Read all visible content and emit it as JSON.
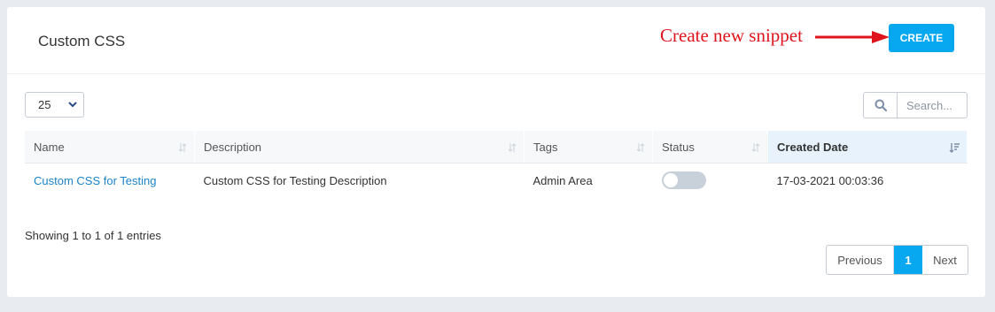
{
  "header": {
    "title": "Custom CSS",
    "annotation": "Create new snippet",
    "create_label": "CREATE"
  },
  "controls": {
    "page_length": "25",
    "search_placeholder": "Search..."
  },
  "table": {
    "columns": [
      "Name",
      "Description",
      "Tags",
      "Status",
      "Created Date"
    ],
    "sorted_column": "Created Date",
    "rows": [
      {
        "name": "Custom CSS for Testing",
        "description": "Custom CSS for Testing Description",
        "tags": "Admin Area",
        "status_enabled": false,
        "created": "17-03-2021 00:03:36"
      }
    ]
  },
  "footer": {
    "info": "Showing 1 to 1 of 1 entries",
    "previous": "Previous",
    "current_page": "1",
    "next": "Next"
  },
  "colors": {
    "accent": "#08a8f1",
    "annotation": "#e0141c",
    "link": "#1c83c6"
  }
}
